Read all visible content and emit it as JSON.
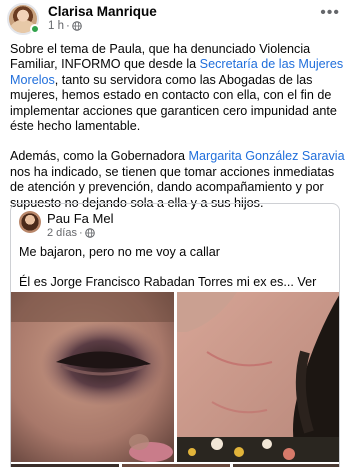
{
  "post": {
    "author": "Clarisa Manrique",
    "time": "1 h",
    "separator": "·",
    "more_icon": "ellipsis-icon",
    "paragraph1_a": "Sobre el tema de Paula, que ha denunciado Violencia Familiar, INFORMO que desde la ",
    "paragraph1_link": "Secretaría de las Mujeres Morelos",
    "paragraph1_b": ", tanto su servidora como las Abogadas de las mujeres, hemos estado en contacto con ella, con el fin de implementar acciones que garanticen cero impunidad ante éste hecho lamentable.",
    "paragraph2_a": "Además, como la Gobernadora ",
    "paragraph2_link": "Margarita González Saravia",
    "paragraph2_b": " nos ha indicado, se tienen que tomar acciones inmediatas de atención y prevención, dando acompañamiento y por supuesto no dejando sola a ella y a sus hijos."
  },
  "shared_post": {
    "author": "Pau Fa Mel",
    "time": "2 días",
    "separator": "·",
    "line1": "Me bajaron, pero no me voy a callar",
    "line2": "Él es Jorge Francisco Rabadan Torres mi ex es...",
    "see_more": "Ver más"
  },
  "colors": {
    "link": "#216fdb",
    "secondary_text": "#65676b",
    "online": "#31a24c"
  }
}
